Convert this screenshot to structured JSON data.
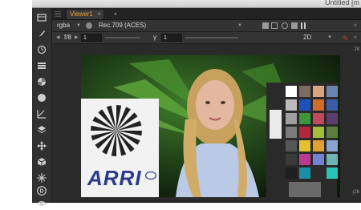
{
  "window": {
    "title": "Untitled [m"
  },
  "tabs": [
    {
      "label": "Viewer1",
      "close": "×"
    }
  ],
  "controls": {
    "channels": "rgba",
    "colorspace": "Rec.709 (ACES)",
    "fstop_label": "f/8",
    "fstop_value": "1",
    "gamma_label": "γ",
    "gamma_value": "1",
    "view_mode": "2D"
  },
  "viewport": {
    "corner_top_right": "28",
    "corner_bottom_right": "(26"
  },
  "image": {
    "logo_text": "ARRI"
  },
  "icons": [
    "layout-icon",
    "paint-brush-icon",
    "clock-icon",
    "list-icon",
    "color-wheel-icon",
    "circle-icon",
    "curve-tool-icon",
    "layers-icon",
    "transform-icon",
    "cube-icon",
    "sparkle-icon",
    "d-icon",
    "eye-icon"
  ],
  "colors": {
    "accent_tab": "#f0a030",
    "background": "#2b2b2b"
  }
}
